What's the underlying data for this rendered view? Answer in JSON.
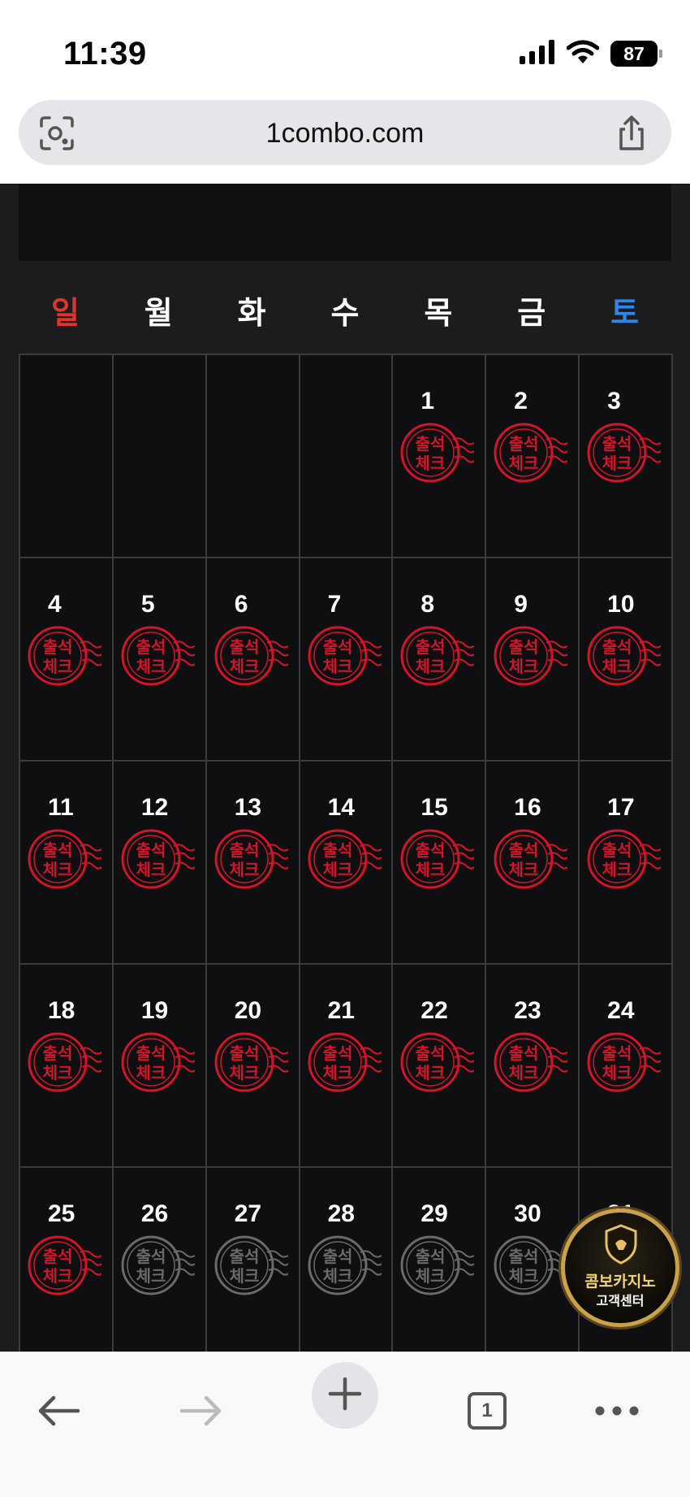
{
  "status_bar": {
    "time": "11:39",
    "battery": "87",
    "icons": [
      "signal-icon",
      "wifi-icon",
      "battery-icon"
    ]
  },
  "browser": {
    "url": "1combo.com",
    "icons": [
      "lens-icon",
      "share-icon"
    ]
  },
  "calendar": {
    "weekdays": [
      "일",
      "월",
      "화",
      "수",
      "목",
      "금",
      "토"
    ],
    "weekday_colors": {
      "sunday": "#e0352b",
      "saturday": "#2f86e8",
      "default": "#ffffff"
    },
    "stamp": {
      "line1": "출석",
      "line2": "체크",
      "active_color": "#d3142a",
      "inactive_color": "#6a6a6e"
    },
    "days": [
      {
        "num": "",
        "stamp": false,
        "active": false
      },
      {
        "num": "",
        "stamp": false,
        "active": false
      },
      {
        "num": "",
        "stamp": false,
        "active": false
      },
      {
        "num": "",
        "stamp": false,
        "active": false
      },
      {
        "num": "1",
        "stamp": true,
        "active": true
      },
      {
        "num": "2",
        "stamp": true,
        "active": true
      },
      {
        "num": "3",
        "stamp": true,
        "active": true
      },
      {
        "num": "4",
        "stamp": true,
        "active": true
      },
      {
        "num": "5",
        "stamp": true,
        "active": true
      },
      {
        "num": "6",
        "stamp": true,
        "active": true
      },
      {
        "num": "7",
        "stamp": true,
        "active": true
      },
      {
        "num": "8",
        "stamp": true,
        "active": true
      },
      {
        "num": "9",
        "stamp": true,
        "active": true
      },
      {
        "num": "10",
        "stamp": true,
        "active": true
      },
      {
        "num": "11",
        "stamp": true,
        "active": true
      },
      {
        "num": "12",
        "stamp": true,
        "active": true
      },
      {
        "num": "13",
        "stamp": true,
        "active": true
      },
      {
        "num": "14",
        "stamp": true,
        "active": true
      },
      {
        "num": "15",
        "stamp": true,
        "active": true
      },
      {
        "num": "16",
        "stamp": true,
        "active": true
      },
      {
        "num": "17",
        "stamp": true,
        "active": true
      },
      {
        "num": "18",
        "stamp": true,
        "active": true
      },
      {
        "num": "19",
        "stamp": true,
        "active": true
      },
      {
        "num": "20",
        "stamp": true,
        "active": true
      },
      {
        "num": "21",
        "stamp": true,
        "active": true
      },
      {
        "num": "22",
        "stamp": true,
        "active": true
      },
      {
        "num": "23",
        "stamp": true,
        "active": true
      },
      {
        "num": "24",
        "stamp": true,
        "active": true
      },
      {
        "num": "25",
        "stamp": true,
        "active": true
      },
      {
        "num": "26",
        "stamp": true,
        "active": false
      },
      {
        "num": "27",
        "stamp": true,
        "active": false
      },
      {
        "num": "28",
        "stamp": true,
        "active": false
      },
      {
        "num": "29",
        "stamp": true,
        "active": false
      },
      {
        "num": "30",
        "stamp": true,
        "active": false
      },
      {
        "num": "31",
        "stamp": true,
        "active": false
      }
    ]
  },
  "chat_badge": {
    "line1": "콤보카지노",
    "line2": "고객센터"
  },
  "bottom_nav": {
    "tab_count": "1",
    "icons": [
      "back-arrow-icon",
      "forward-arrow-icon",
      "plus-icon",
      "tabs-icon",
      "more-icon"
    ]
  }
}
